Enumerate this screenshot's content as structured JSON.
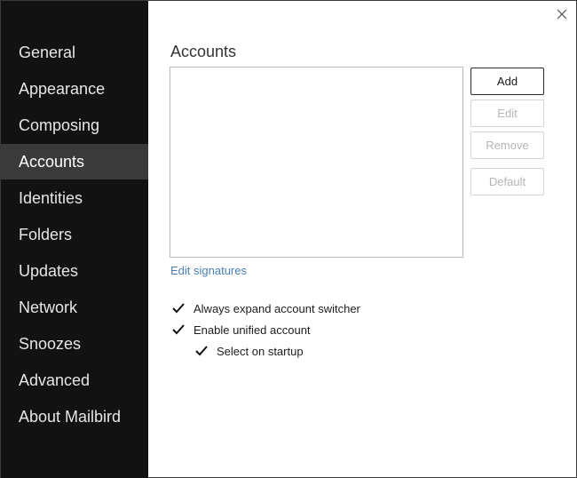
{
  "sidebar": {
    "items": [
      {
        "label": "General"
      },
      {
        "label": "Appearance"
      },
      {
        "label": "Composing"
      },
      {
        "label": "Accounts"
      },
      {
        "label": "Identities"
      },
      {
        "label": "Folders"
      },
      {
        "label": "Updates"
      },
      {
        "label": "Network"
      },
      {
        "label": "Snoozes"
      },
      {
        "label": "Advanced"
      },
      {
        "label": "About Mailbird"
      }
    ],
    "active": "Accounts"
  },
  "main": {
    "title": "Accounts",
    "buttons": {
      "add": "Add",
      "edit": "Edit",
      "remove": "Remove",
      "default": "Default"
    },
    "edit_signatures_link": "Edit signatures",
    "options": [
      {
        "label": "Always expand account switcher",
        "checked": true
      },
      {
        "label": "Enable unified account",
        "checked": true
      },
      {
        "label": "Select on startup",
        "checked": true
      }
    ]
  },
  "colors": {
    "sidebar_bg": "#121212",
    "sidebar_active_bg": "#3a3a3a",
    "link": "#4a7fb8"
  }
}
